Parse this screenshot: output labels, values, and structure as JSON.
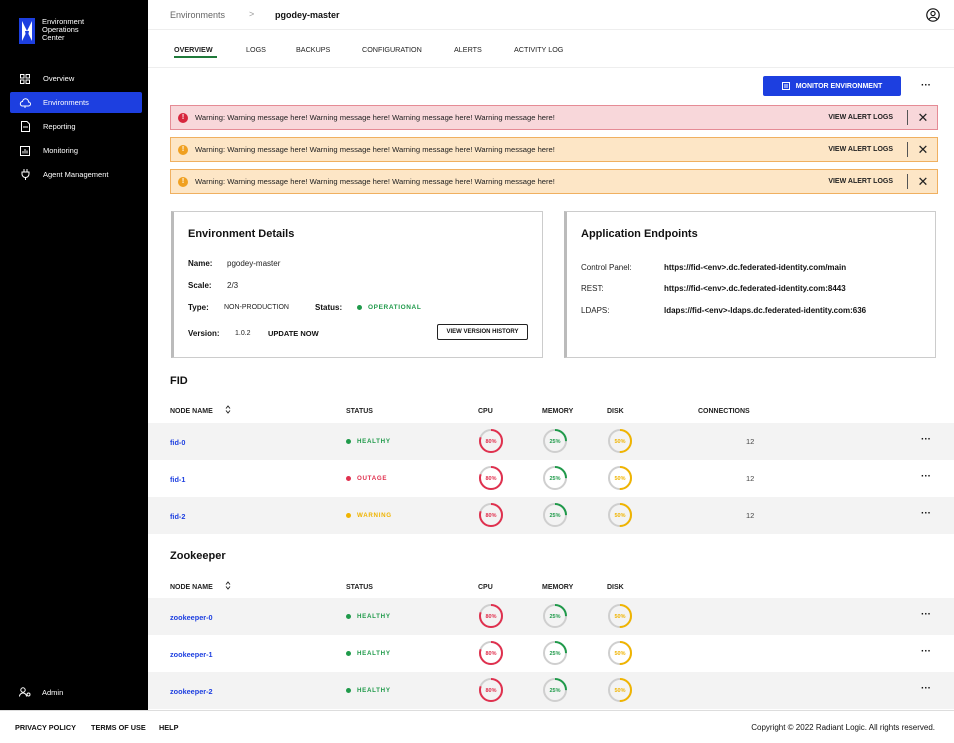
{
  "app": {
    "name_line1": "Environment",
    "name_line2": "Operations",
    "name_line3": "Center"
  },
  "sidebar": {
    "items": [
      {
        "label": "Overview",
        "icon": "grid-icon"
      },
      {
        "label": "Environments",
        "icon": "cloud-icon"
      },
      {
        "label": "Reporting",
        "icon": "document-icon"
      },
      {
        "label": "Monitoring",
        "icon": "chart-icon"
      },
      {
        "label": "Agent Management",
        "icon": "plug-icon"
      }
    ],
    "admin_label": "Admin"
  },
  "breadcrumb": {
    "parent": "Environments",
    "separator": ">",
    "current": "pgodey-master"
  },
  "tabs": [
    "OVERVIEW",
    "LOGS",
    "BACKUPS",
    "CONFIGURATION",
    "ALERTS",
    "ACTIVITY LOG"
  ],
  "actions": {
    "monitor_label": "MONITOR ENVIRONMENT",
    "more": "···"
  },
  "alerts": [
    {
      "type": "error",
      "message": "Warning: Warning message here! Warning message here! Warning message here! Warning message here!",
      "link": "VIEW ALERT LOGS",
      "icon_glyph": "!"
    },
    {
      "type": "warn",
      "message": "Warning: Warning message here! Warning message here! Warning message here! Warning message here!",
      "link": "VIEW ALERT LOGS",
      "icon_glyph": "!"
    },
    {
      "type": "warn",
      "message": "Warning: Warning message here! Warning message here! Warning message here! Warning message here!",
      "link": "VIEW ALERT LOGS",
      "icon_glyph": "!"
    }
  ],
  "env_details": {
    "title": "Environment Details",
    "name_label": "Name:",
    "name_value": "pgodey-master",
    "scale_label": "Scale:",
    "scale_value": "2/3",
    "type_label": "Type:",
    "type_value": "NON-PRODUCTION",
    "status_label": "Status:",
    "status_value": "OPERATIONAL",
    "version_label": "Version:",
    "version_value": "1.0.2",
    "update_label": "UPDATE NOW",
    "history_label": "VIEW VERSION HISTORY"
  },
  "endpoints": {
    "title": "Application Endpoints",
    "items": [
      {
        "label": "Control Panel:",
        "value": "https://fid-<env>.dc.federated-identity.com/main"
      },
      {
        "label": "REST:",
        "value": "https://fid-<env>.dc.federated-identity.com:8443"
      },
      {
        "label": "LDAPS:",
        "value": "ldaps://fid-<env>-ldaps.dc.federated-identity.com:636"
      }
    ]
  },
  "fid": {
    "title": "FID",
    "headers": {
      "node": "NODE NAME",
      "status": "STATUS",
      "cpu": "CPU",
      "memory": "MEMORY",
      "disk": "DISK",
      "connections": "CONNECTIONS"
    },
    "rows": [
      {
        "name": "fid-0",
        "status": "HEALTHY",
        "status_color": "#1f9a4a",
        "cpu": 80,
        "memory": 25,
        "disk": 50,
        "connections": "12"
      },
      {
        "name": "fid-1",
        "status": "OUTAGE",
        "status_color": "#e0304e",
        "cpu": 80,
        "memory": 25,
        "disk": 50,
        "connections": "12"
      },
      {
        "name": "fid-2",
        "status": "WARNING",
        "status_color": "#f0b400",
        "cpu": 80,
        "memory": 25,
        "disk": 50,
        "connections": "12"
      }
    ]
  },
  "zookeeper": {
    "title": "Zookeeper",
    "headers": {
      "node": "NODE NAME",
      "status": "STATUS",
      "cpu": "CPU",
      "memory": "MEMORY",
      "disk": "DISK"
    },
    "rows": [
      {
        "name": "zookeeper-0",
        "status": "HEALTHY",
        "status_color": "#1f9a4a",
        "cpu": 80,
        "memory": 25,
        "disk": 50
      },
      {
        "name": "zookeeper-1",
        "status": "HEALTHY",
        "status_color": "#1f9a4a",
        "cpu": 80,
        "memory": 25,
        "disk": 50
      },
      {
        "name": "zookeeper-2",
        "status": "HEALTHY",
        "status_color": "#1f9a4a",
        "cpu": 80,
        "memory": 25,
        "disk": 50
      }
    ]
  },
  "gauge_colors": {
    "cpu": "#e0304e",
    "memory": "#1f9a4a",
    "disk": "#f0b400",
    "track": "#cfcfcf"
  },
  "footer": {
    "links": [
      "PRIVACY POLICY",
      "TERMS OF USE",
      "HELP"
    ],
    "copyright": "Copyright © 2022 Radiant Logic. All rights reserved."
  }
}
